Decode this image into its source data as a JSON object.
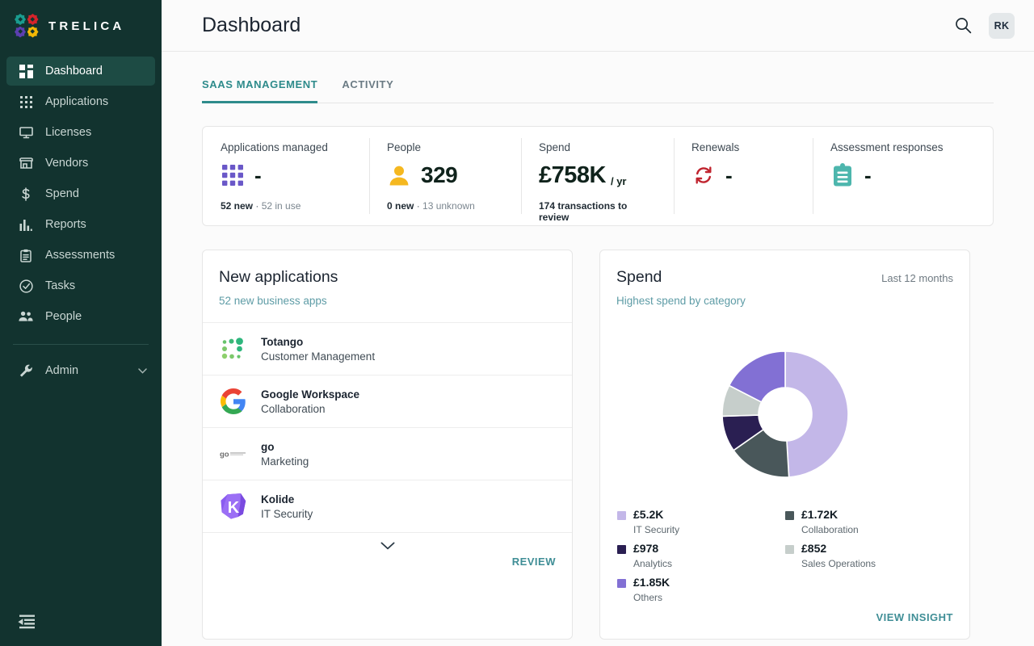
{
  "brand": {
    "name": "TRELICA",
    "logo_colors": [
      "#1a9c8f",
      "#d5232a",
      "#5b3fb0",
      "#f2b705"
    ]
  },
  "sidebar": {
    "items": [
      {
        "label": "Dashboard",
        "icon": "dashboard-icon",
        "active": true
      },
      {
        "label": "Applications",
        "icon": "apps-grid-icon",
        "active": false
      },
      {
        "label": "Licenses",
        "icon": "monitor-icon",
        "active": false
      },
      {
        "label": "Vendors",
        "icon": "store-icon",
        "active": false
      },
      {
        "label": "Spend",
        "icon": "dollar-icon",
        "active": false
      },
      {
        "label": "Reports",
        "icon": "bar-chart-icon",
        "active": false
      },
      {
        "label": "Assessments",
        "icon": "clipboard-icon",
        "active": false
      },
      {
        "label": "Tasks",
        "icon": "check-circle-icon",
        "active": false
      },
      {
        "label": "People",
        "icon": "people-icon",
        "active": false
      }
    ],
    "admin": {
      "label": "Admin",
      "icon": "wrench-icon",
      "chevron": "chevron-down-icon"
    },
    "collapse": "collapse-sidebar-icon"
  },
  "header": {
    "title": "Dashboard",
    "search_icon": "search-icon",
    "avatar_initials": "RK"
  },
  "tabs": [
    {
      "label": "SAAS MANAGEMENT",
      "active": true
    },
    {
      "label": "ACTIVITY",
      "active": false
    }
  ],
  "kpis": [
    {
      "label": "Applications managed",
      "icon": "apps-grid-icon",
      "value": "-",
      "unit": "",
      "sub_bold": "52 new",
      "sub_sep": " · ",
      "sub_muted": "52 in use"
    },
    {
      "label": "People",
      "icon": "person-icon",
      "value": "329",
      "unit": "",
      "sub_bold": "0 new",
      "sub_sep": " · ",
      "sub_muted": "13 unknown"
    },
    {
      "label": "Spend",
      "icon": "",
      "value": "£758K",
      "unit": "/ yr",
      "sub_bold": "174 transactions to review",
      "sub_sep": "",
      "sub_muted": ""
    },
    {
      "label": "Renewals",
      "icon": "renew-icon",
      "value": "-",
      "unit": "",
      "sub_bold": "",
      "sub_sep": "",
      "sub_muted": ""
    },
    {
      "label": "Assessment responses",
      "icon": "clipboard-icon",
      "value": "-",
      "unit": "",
      "sub_bold": "",
      "sub_sep": "",
      "sub_muted": ""
    }
  ],
  "new_applications": {
    "title": "New applications",
    "link": "52 new business apps",
    "rows": [
      {
        "name": "Totango",
        "category": "Customer Management",
        "logo": "totango-logo"
      },
      {
        "name": "Google Workspace",
        "category": "Collaboration",
        "logo": "google-logo"
      },
      {
        "name": "go",
        "category": "Marketing",
        "logo": "go-logo"
      },
      {
        "name": "Kolide",
        "category": "IT Security",
        "logo": "kolide-logo"
      }
    ],
    "expand_icon": "chevron-down-icon",
    "action": "REVIEW"
  },
  "spend_card": {
    "title": "Spend",
    "period": "Last 12 months",
    "link": "Highest spend by category",
    "action": "VIEW INSIGHT"
  },
  "chart_data": {
    "type": "pie",
    "title": "Highest spend by category",
    "subtitle": "Last 12 months",
    "donut": true,
    "currency": "£",
    "legend_position": "bottom",
    "categories": [
      "IT Security",
      "Collaboration",
      "Analytics",
      "Sales Operations",
      "Others"
    ],
    "value_labels": [
      "£5.2K",
      "£1.72K",
      "£978",
      "£852",
      "£1.85K"
    ],
    "values": [
      5200,
      1720,
      978,
      852,
      1850
    ],
    "colors": [
      "#c3b7e8",
      "#49575a",
      "#2a1f52",
      "#c6cecb",
      "#8270d4"
    ],
    "total": 10600
  }
}
